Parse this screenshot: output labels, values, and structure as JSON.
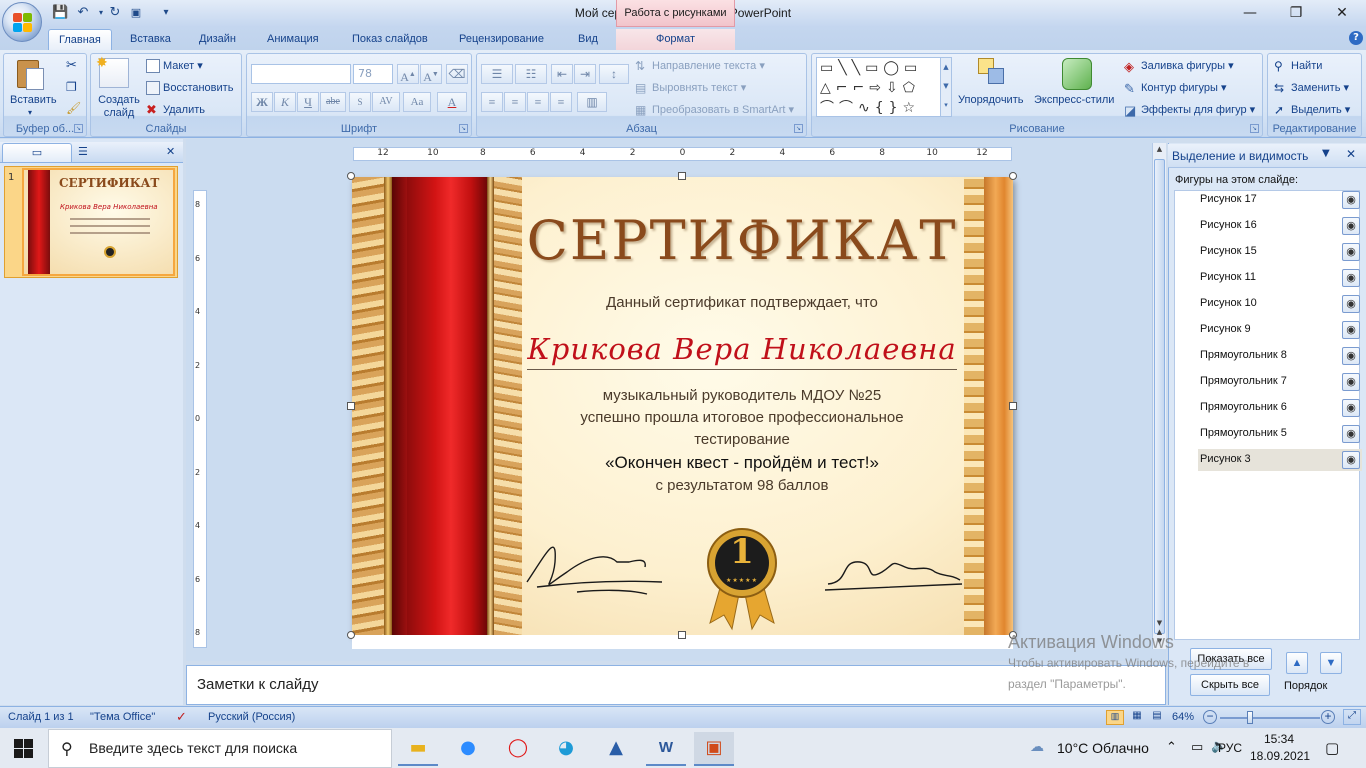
{
  "window": {
    "title": "Мой сертификат - Microsoft PowerPoint",
    "context_tab_group": "Работа с рисунками",
    "controls": {
      "minimize": "—",
      "restore": "❐",
      "close": "✕"
    }
  },
  "tabs": [
    {
      "label": "Главная",
      "active": true
    },
    {
      "label": "Вставка"
    },
    {
      "label": "Дизайн"
    },
    {
      "label": "Анимация"
    },
    {
      "label": "Показ слайдов"
    },
    {
      "label": "Рецензирование"
    },
    {
      "label": "Вид"
    },
    {
      "label": "Формат",
      "context": true
    }
  ],
  "ribbon": {
    "clipboard": {
      "paste": "Вставить",
      "group": "Буфер об..."
    },
    "slides": {
      "new_slide": "Создать слайд",
      "layout": "Макет",
      "reset": "Восстановить",
      "delete": "Удалить",
      "group": "Слайды"
    },
    "font": {
      "size": "78",
      "bold": "Ж",
      "italic": "К",
      "underline": "Ч",
      "strike": "abe",
      "spacing": "AV",
      "case": "Aa",
      "color": "A",
      "group": "Шрифт"
    },
    "paragraph": {
      "text_direction": "Направление текста",
      "align_text": "Выровнять текст",
      "smartart": "Преобразовать в SmartArt",
      "group": "Абзац"
    },
    "drawing": {
      "arrange": "Упорядочить",
      "quick_styles": "Экспресс-стили",
      "fill": "Заливка фигуры",
      "outline": "Контур фигуры",
      "effects": "Эффекты для фигур",
      "group": "Рисование"
    },
    "editing": {
      "find": "Найти",
      "replace": "Заменить",
      "select": "Выделить",
      "group": "Редактирование"
    }
  },
  "slides_pane": {
    "slide_number": "1"
  },
  "ruler": {
    "labels": [
      "12",
      "10",
      "8",
      "6",
      "4",
      "2",
      "0",
      "2",
      "4",
      "6",
      "8",
      "10",
      "12"
    ]
  },
  "vruler": {
    "labels": [
      "8",
      "6",
      "4",
      "2",
      "0",
      "2",
      "4",
      "6",
      "8"
    ]
  },
  "slide": {
    "title": "СЕРТИФИКАТ",
    "subtitle": "Данный сертификат подтверждает, что",
    "name": "Крикова Вера Николаевна",
    "line1": "музыкальный руководитель МДОУ №25",
    "line2": "успешно прошла итоговое профессиональное",
    "line3": "тестирование",
    "line4": "«Окончен квест - пройдём и тест!»",
    "line5": "с результатом 98 баллов",
    "medal_number": "1",
    "medal_stars": "★★★★★"
  },
  "notes": {
    "placeholder": "Заметки к слайду"
  },
  "selection_pane": {
    "title": "Выделение и видимость",
    "list_label": "Фигуры на этом слайде:",
    "items": [
      {
        "label": "Рисунок 17"
      },
      {
        "label": "Рисунок 16"
      },
      {
        "label": "Рисунок 15"
      },
      {
        "label": "Рисунок 11"
      },
      {
        "label": "Рисунок 10"
      },
      {
        "label": "Рисунок 9"
      },
      {
        "label": "Прямоугольник 8"
      },
      {
        "label": "Прямоугольник 7"
      },
      {
        "label": "Прямоугольник 6"
      },
      {
        "label": "Прямоугольник 5"
      },
      {
        "label": "Рисунок 3",
        "selected": true
      }
    ],
    "show_all": "Показать все",
    "hide_all": "Скрыть все",
    "order": "Порядок"
  },
  "watermark": {
    "line1": "Активация Windows",
    "line2": "Чтобы активировать Windows, перейдите в",
    "line3": "раздел \"Параметры\"."
  },
  "status": {
    "slide": "Слайд 1 из 1",
    "theme": "\"Тема Office\"",
    "language": "Русский (Россия)",
    "zoom": "64%",
    "zoom_value": 0.64
  },
  "taskbar": {
    "search_placeholder": "Введите здесь текст для поиска",
    "weather": "10°C  Облачно",
    "lang": "РУС",
    "time": "15:34",
    "date": "18.09.2021"
  },
  "colors": {
    "ribbon_text": "#15428b",
    "title_brown": "#8a4a1c",
    "name_red": "#c0101a",
    "ctx_pink": "#f2c4cb"
  }
}
